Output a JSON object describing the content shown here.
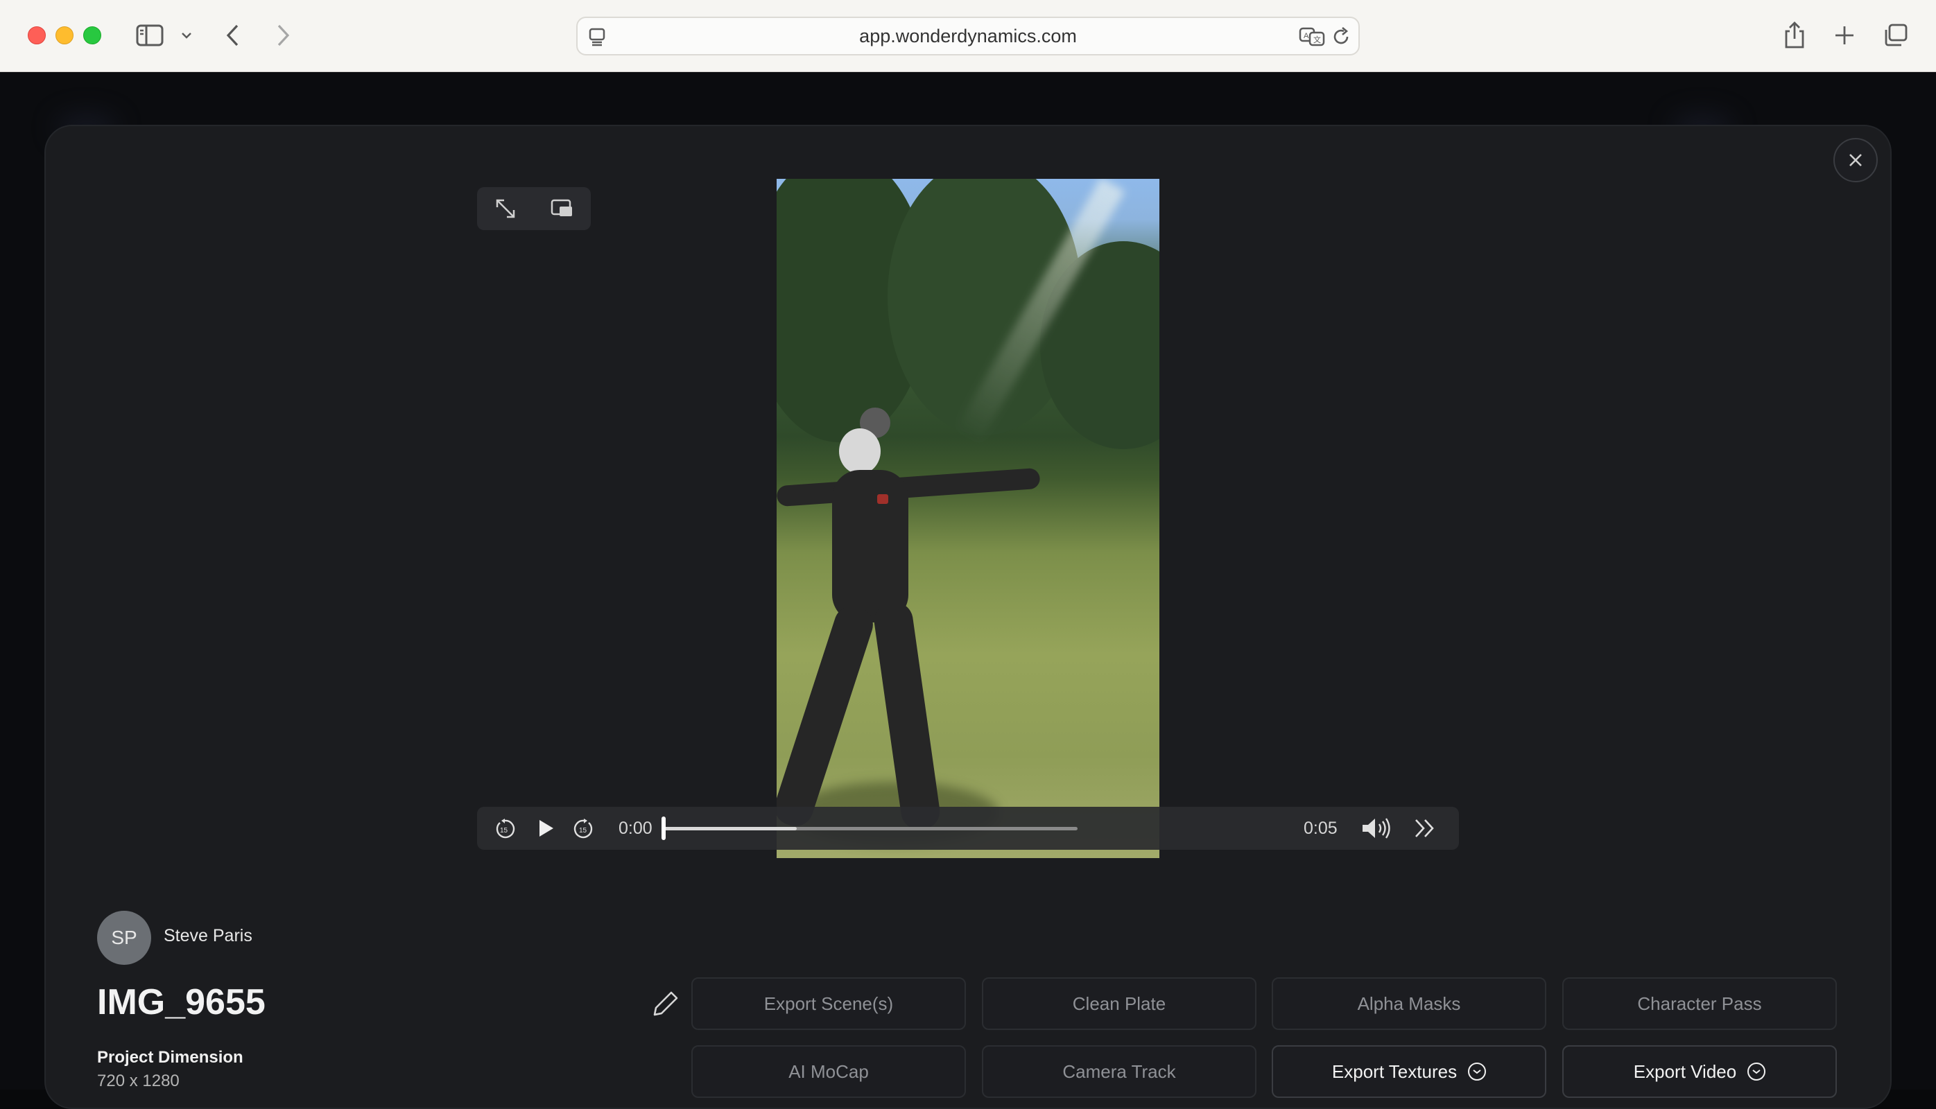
{
  "browser": {
    "url": "app.wonderdynamics.com"
  },
  "viewer": {
    "player": {
      "current_time": "0:00",
      "duration": "0:05",
      "progress": 0.0,
      "buffered": 0.32
    }
  },
  "project": {
    "owner_initials": "SP",
    "owner_name": "Steve Paris",
    "title": "IMG_9655",
    "dimension_label": "Project Dimension",
    "dimension_value": "720 x 1280"
  },
  "actions": [
    {
      "label": "Export Scene(s)",
      "active": false
    },
    {
      "label": "Clean Plate",
      "active": false
    },
    {
      "label": "Alpha Masks",
      "active": false
    },
    {
      "label": "Character Pass",
      "active": false
    },
    {
      "label": "AI MoCap",
      "active": false
    },
    {
      "label": "Camera Track",
      "active": false
    },
    {
      "label": "Export Textures",
      "active": true,
      "dropdown": true
    },
    {
      "label": "Export Video",
      "active": true,
      "dropdown": true
    }
  ],
  "icons": {
    "sidebar": "sidebar-icon",
    "back": "chevron-left-icon",
    "forward": "chevron-right-icon",
    "share": "share-icon",
    "new_tab": "plus-icon",
    "tabs": "tabs-overview-icon",
    "close": "close-icon"
  }
}
